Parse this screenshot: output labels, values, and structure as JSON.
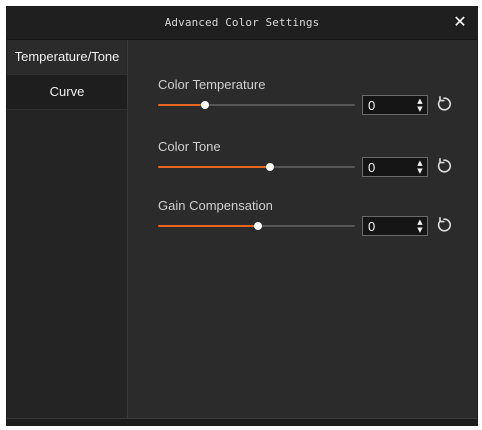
{
  "window": {
    "title": "Advanced Color Settings",
    "close_icon": "close-icon"
  },
  "sidebar": {
    "tabs": [
      {
        "label": "Temperature/Tone",
        "active": true
      },
      {
        "label": "Curve",
        "active": false
      }
    ]
  },
  "settings": [
    {
      "label": "Color Temperature",
      "value": "0",
      "slider_fraction": 0.24,
      "reset_icon": "reset-icon"
    },
    {
      "label": "Color Tone",
      "value": "0",
      "slider_fraction": 0.57,
      "reset_icon": "reset-icon"
    },
    {
      "label": "Gain Compensation",
      "value": "0",
      "slider_fraction": 0.51,
      "reset_icon": "reset-icon"
    }
  ],
  "colors": {
    "background": "#2b2b2b",
    "titlebar": "#1f1f1f",
    "accent": "#e8661d",
    "text": "#cfcfcf",
    "thumb": "#ffffff"
  }
}
